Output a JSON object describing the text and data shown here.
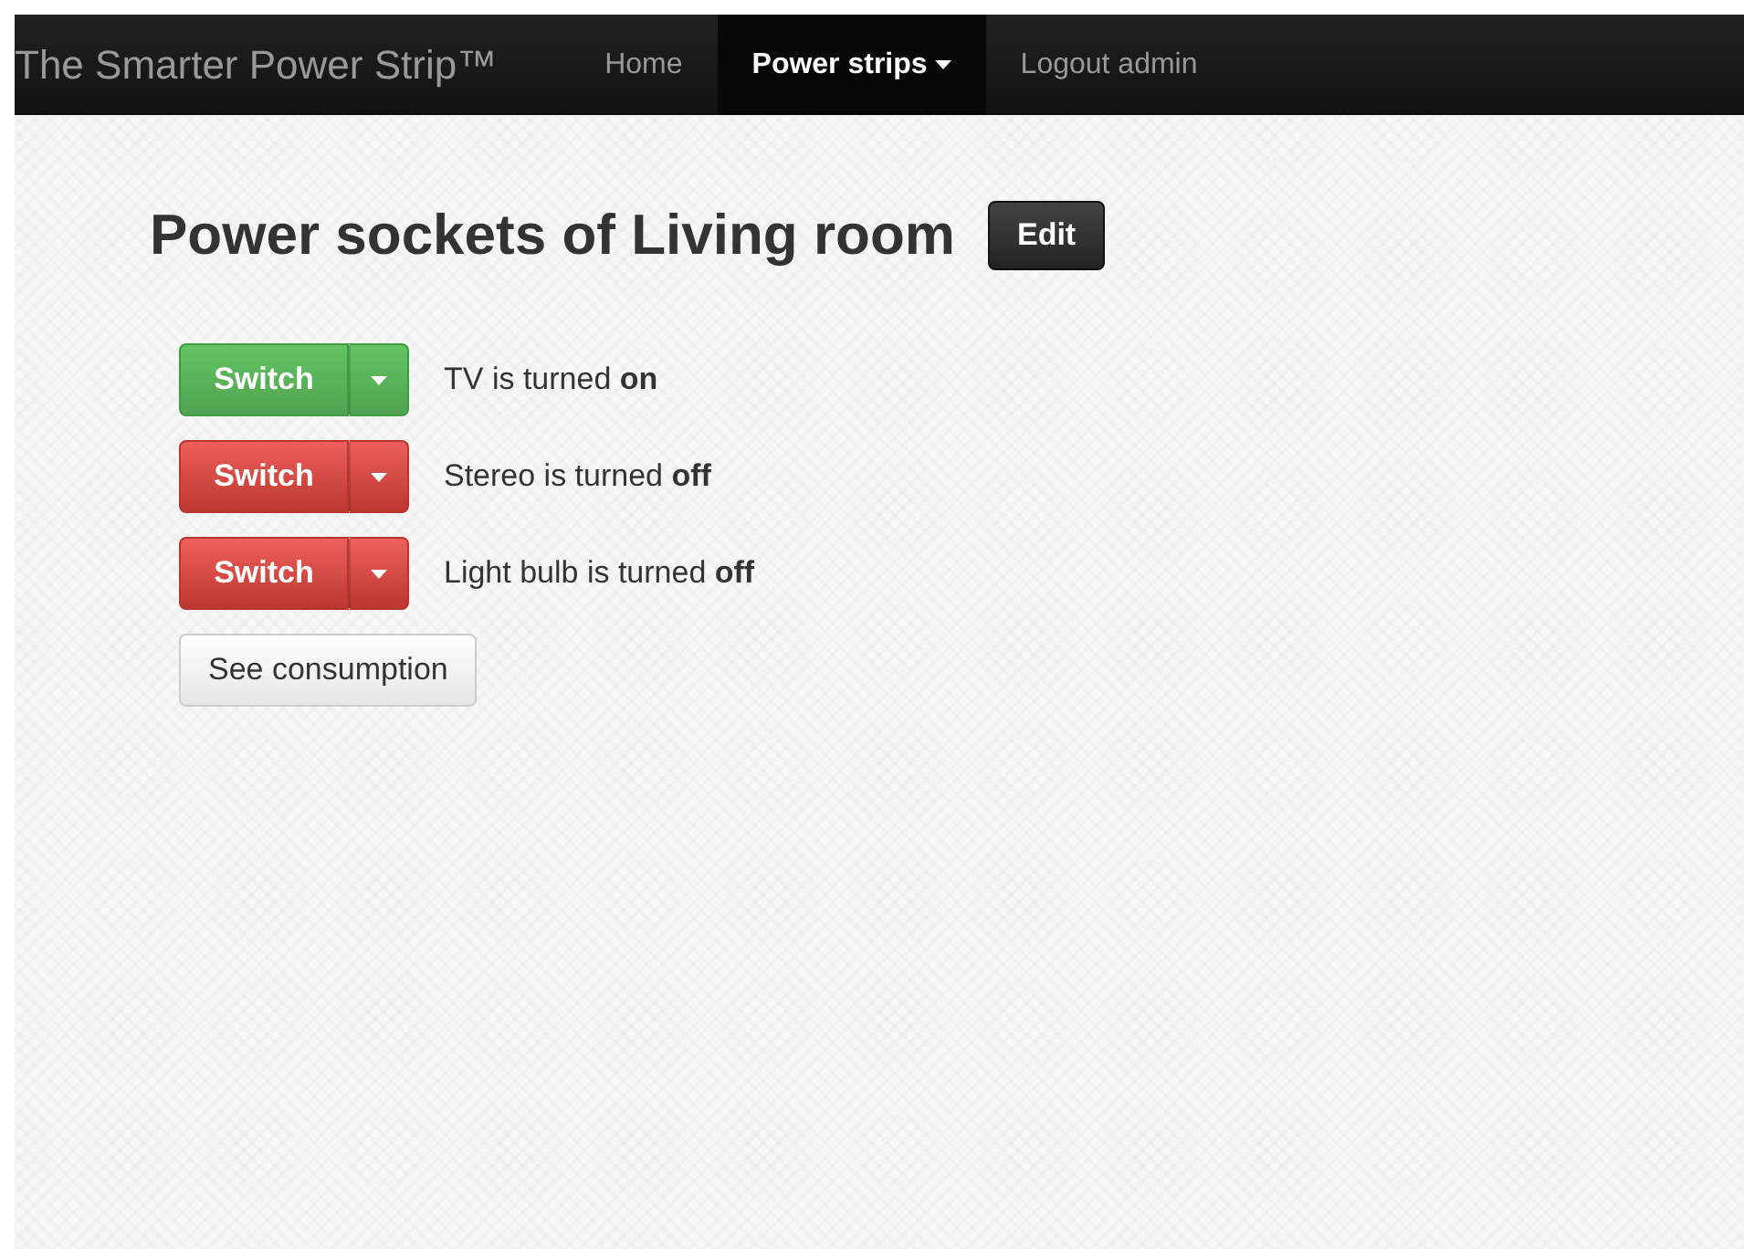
{
  "navbar": {
    "brand": "The Smarter Power Strip™",
    "items": [
      {
        "label": "Home",
        "selected": false,
        "dropdown": false
      },
      {
        "label": "Power strips",
        "selected": true,
        "dropdown": true
      },
      {
        "label": "Logout admin",
        "selected": false,
        "dropdown": false
      }
    ]
  },
  "heading": {
    "title": "Power sockets of Living room",
    "edit_button": "Edit"
  },
  "sockets": [
    {
      "button": "Switch",
      "on": true,
      "status": "TV is turned **on**"
    },
    {
      "button": "Switch",
      "on": false,
      "status": "Stereo is turned **off**"
    },
    {
      "button": "Switch",
      "on": false,
      "status": "Light bulb is turned **off**"
    }
  ],
  "consumption_button": "See consumption"
}
